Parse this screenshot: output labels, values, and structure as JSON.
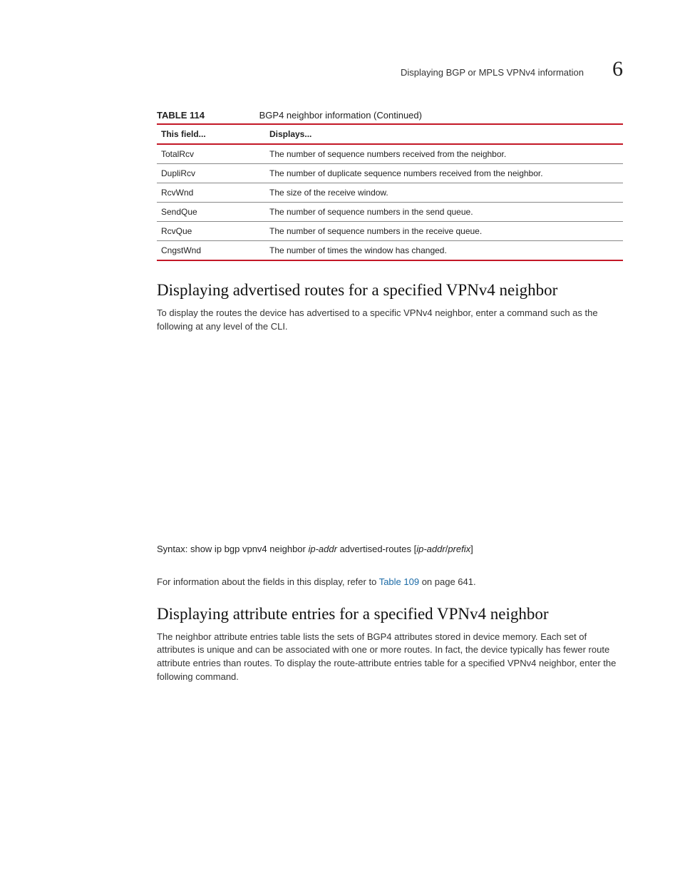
{
  "header": {
    "running_title": "Displaying BGP or MPLS VPNv4 information",
    "chapter_number": "6"
  },
  "table": {
    "number_label": "TABLE 114",
    "title": "BGP4 neighbor information  (Continued)",
    "col_field": "This field...",
    "col_displays": "Displays...",
    "rows": [
      {
        "field": "TotalRcv",
        "displays": "The number of sequence numbers received from the neighbor."
      },
      {
        "field": "DupliRcv",
        "displays": "The number of duplicate sequence numbers received from the neighbor."
      },
      {
        "field": "RcvWnd",
        "displays": "The size of the receive window."
      },
      {
        "field": "SendQue",
        "displays": "The number of sequence numbers in the send queue."
      },
      {
        "field": "RcvQue",
        "displays": "The number of sequence numbers in the receive queue."
      },
      {
        "field": "CngstWnd",
        "displays": "The number of times the window has changed."
      }
    ]
  },
  "section1": {
    "heading": "Displaying advertised routes for a specified VPNv4 neighbor",
    "para": "To display the routes the device has advertised to a specific VPNv4 neighbor, enter a command such as the following at any level of the CLI.",
    "syntax_prefix": "Syntax:  ",
    "syntax_cmd1": "show ip bgp vpnv4 neighbor ",
    "syntax_arg1": "ip-addr",
    "syntax_cmd2": " advertised-routes [",
    "syntax_arg2": "ip-addr",
    "syntax_slash": "/",
    "syntax_arg3": "prefix",
    "syntax_cmd3": "]",
    "ref_before": "For information about the fields in this display, refer to ",
    "ref_link": "Table 109",
    "ref_after": " on page 641."
  },
  "section2": {
    "heading": "Displaying attribute entries for a specified VPNv4 neighbor",
    "para": "The neighbor attribute entries table lists the sets of BGP4 attributes stored in device memory. Each set of attributes is unique and can be associated with one or more routes. In fact, the device typically has fewer route attribute entries than routes. To display the route-attribute entries table for a specified VPNv4 neighbor, enter the following command."
  }
}
